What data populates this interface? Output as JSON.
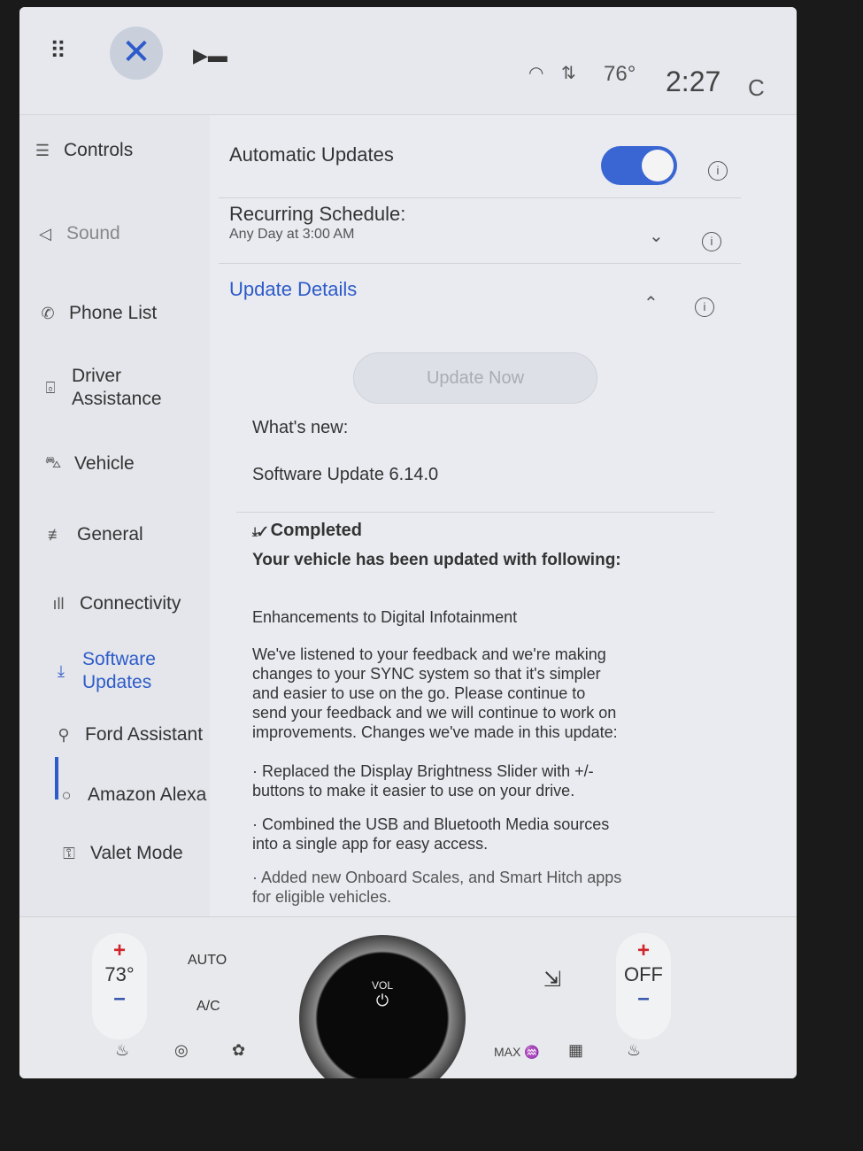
{
  "topbar": {
    "apps_icon": "grid-icon",
    "close_icon": "close-icon",
    "media_icon": "media-icon",
    "wifi_icon": "wifi-icon",
    "data_icon": "signal-arrows-icon",
    "outside_temp": "76°",
    "time": "2:27",
    "user_initial": "C"
  },
  "sidebar": {
    "active": "Software Updates",
    "items": [
      {
        "label": "Controls",
        "icon": "controls-icon"
      },
      {
        "label": "Sound",
        "icon": "speaker-icon"
      },
      {
        "label": "Phone List",
        "icon": "phone-icon"
      },
      {
        "label": "Driver Assistance",
        "icon": "driver-assist-icon"
      },
      {
        "label": "Vehicle",
        "icon": "vehicle-icon"
      },
      {
        "label": "General",
        "icon": "sliders-icon"
      },
      {
        "label": "Connectivity",
        "icon": "signal-icon"
      },
      {
        "label": "Software Updates",
        "icon": "download-icon"
      },
      {
        "label": "Ford Assistant",
        "icon": "assistant-icon"
      },
      {
        "label": "Amazon Alexa",
        "icon": "alexa-icon"
      },
      {
        "label": "Valet Mode",
        "icon": "valet-icon"
      }
    ]
  },
  "main": {
    "automatic_updates": {
      "label": "Automatic Updates",
      "enabled": true
    },
    "recurring_schedule": {
      "label": "Recurring Schedule:",
      "value": "Any Day at 3:00 AM"
    },
    "update_details": {
      "label": "Update Details",
      "expanded": true
    },
    "update_now": "Update Now",
    "whats_new_label": "What's new:",
    "version": "Software Update 6.14.0",
    "status": "Completed",
    "status_sub": "Your vehicle has been updated with following:",
    "heading": "Enhancements to Digital Infotainment",
    "body": "We've listened to your feedback and we're making changes to your SYNC system so that it's simpler and easier to use on the go. Please continue to send your feedback and we will continue to work on improvements. Changes we've made in this update:",
    "bullets": [
      "· Replaced the Display Brightness Slider with +/- buttons to make it easier to use on your drive.",
      "· Combined the USB and Bluetooth Media sources into a single app for easy access.",
      "· Added new Onboard Scales, and Smart Hitch apps for eligible vehicles."
    ]
  },
  "climate": {
    "driver_temp": "73°",
    "auto": "AUTO",
    "ac": "A/C",
    "passenger_temp": "OFF",
    "vol": "VOL",
    "max": "MAX",
    "plus": "+",
    "minus": "–",
    "colors": {
      "plus": "#d0262a",
      "minus": "#2d4fa8"
    }
  }
}
